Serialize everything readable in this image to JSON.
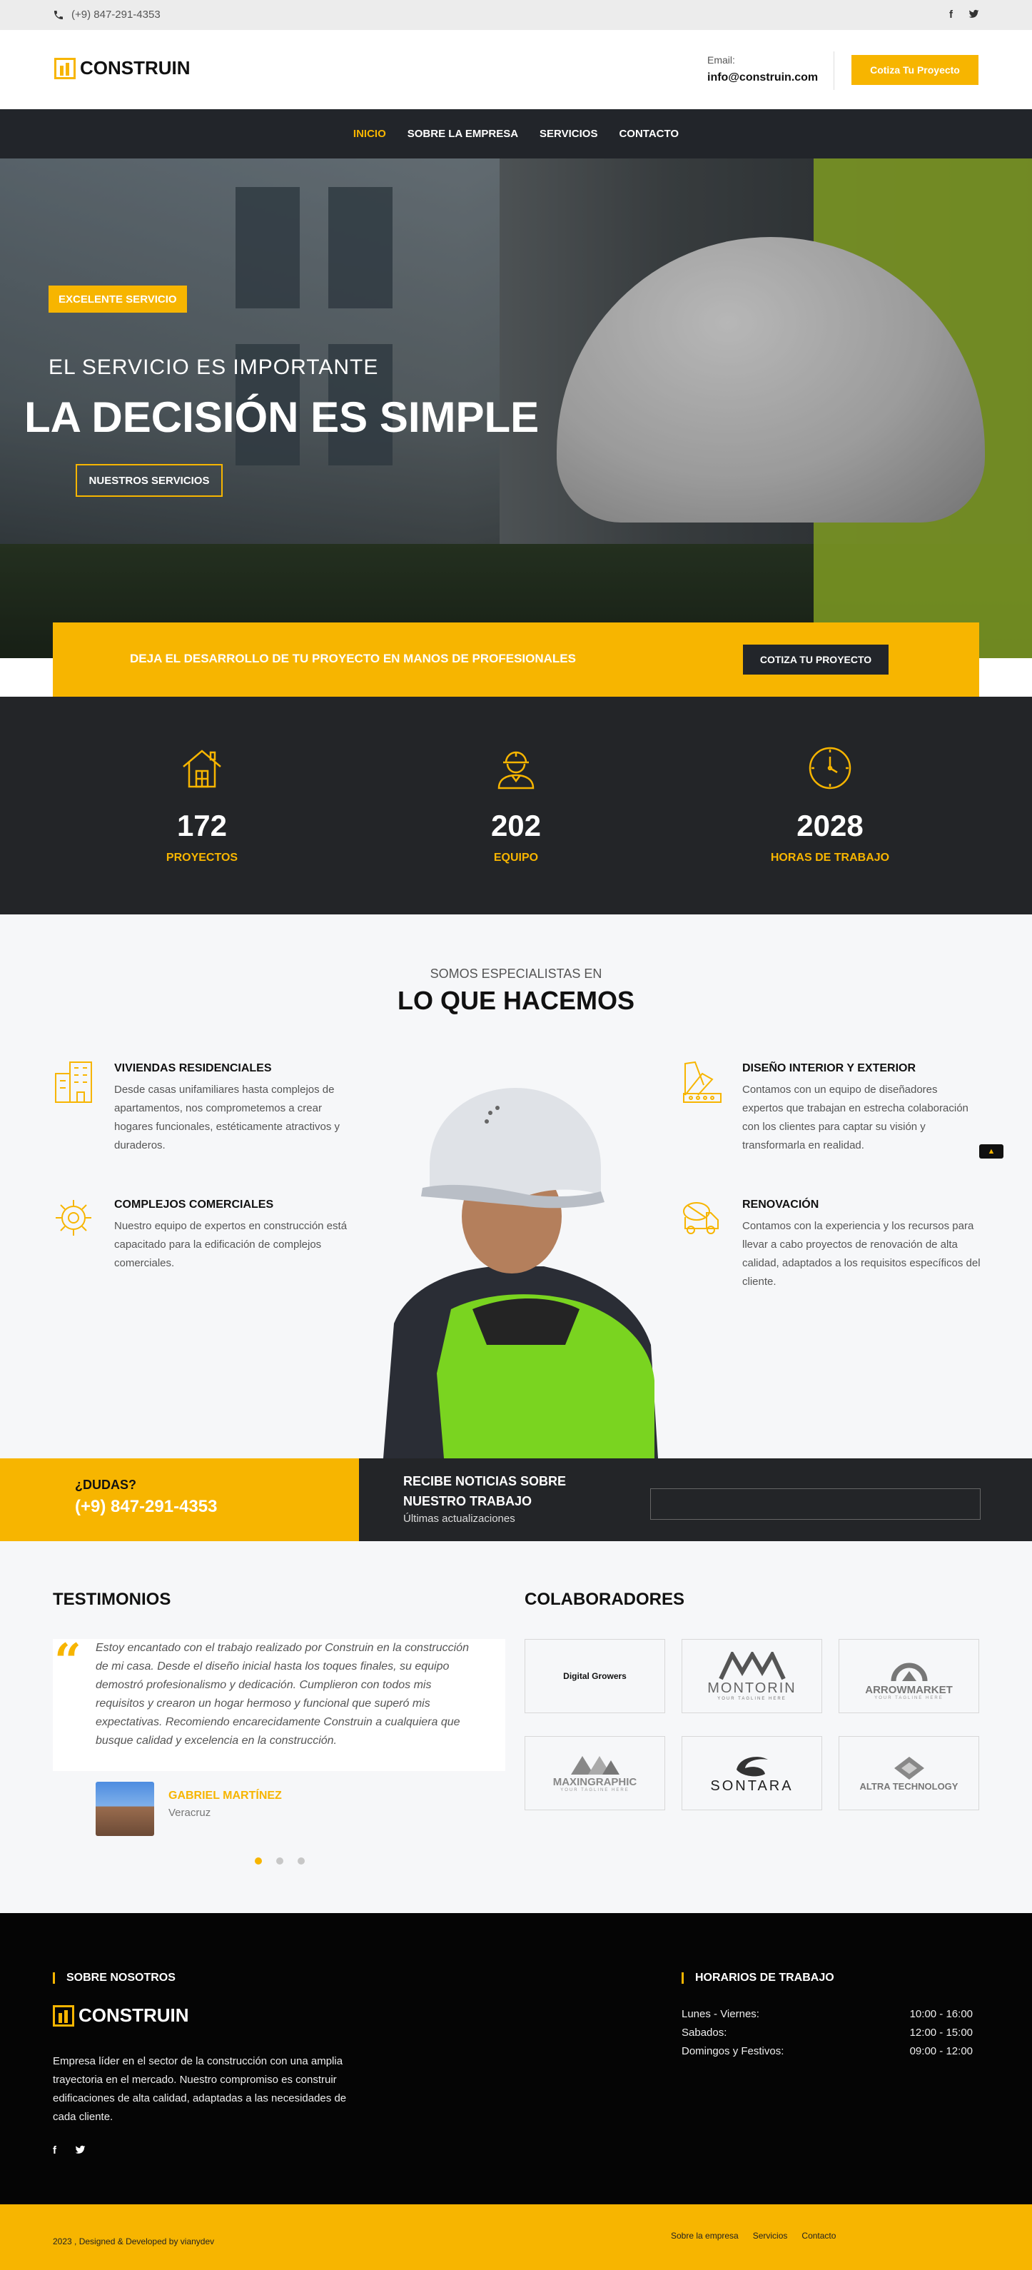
{
  "topbar": {
    "phone": "(+9) 847-291-4353",
    "social_icons": [
      "facebook-icon",
      "twitter-icon"
    ]
  },
  "header": {
    "logo": "CONSTRUIN",
    "email_label": "Email:",
    "email_value": "info@construin.com",
    "cta": "Cotiza Tu Proyecto"
  },
  "nav": {
    "items": [
      {
        "label": "INICIO",
        "active": true
      },
      {
        "label": "SOBRE LA EMPRESA",
        "active": false
      },
      {
        "label": "SERVICIOS",
        "active": false
      },
      {
        "label": "CONTACTO",
        "active": false
      }
    ]
  },
  "hero": {
    "badge": "EXCELENTE SERVICIO",
    "subtitle": "EL SERVICIO ES IMPORTANTE",
    "title": "LA DECISIÓN ES SIMPLE",
    "button": "NUESTROS SERVICIOS"
  },
  "strip": {
    "text": "DEJA EL DESARROLLO DE TU PROYECTO EN MANOS DE PROFESIONALES",
    "button": "COTIZA TU PROYECTO"
  },
  "stats": [
    {
      "value": "172",
      "label": "PROYECTOS",
      "icon": "house-icon"
    },
    {
      "value": "202",
      "label": "EQUIPO",
      "icon": "worker-icon"
    },
    {
      "value": "2028",
      "label": "HORAS DE TRABAJO",
      "icon": "clock-icon"
    }
  ],
  "services": {
    "kicker": "SOMOS ESPECIALISTAS EN",
    "heading": "LO QUE HACEMOS",
    "items": [
      {
        "title": "VIVIENDAS RESIDENCIALES",
        "desc": "Desde casas unifamiliares hasta complejos de apartamentos, nos comprometemos a crear hogares funcionales, estéticamente atractivos y duraderos.",
        "icon": "building-icon"
      },
      {
        "title": "COMPLEJOS COMERCIALES",
        "desc": "Nuestro equipo de expertos en construcción está capacitado para la edificación de complejos comerciales.",
        "icon": "gear-tools-icon"
      },
      {
        "title": "DISEÑO INTERIOR Y EXTERIOR",
        "desc": "Contamos con un equipo de diseñadores expertos que trabajan en estrecha colaboración con los clientes para captar su visión y transformarla en realidad.",
        "icon": "palette-icon"
      },
      {
        "title": "RENOVACIÓN",
        "desc": "Contamos con la experiencia y los recursos para llevar a cabo proyectos de renovación de alta calidad, adaptados a los requisitos específicos del cliente.",
        "icon": "truck-icon"
      }
    ]
  },
  "newsletter": {
    "question": "¿DUDAS?",
    "phone": "(+9) 847-291-4353",
    "title": "RECIBE NOTICIAS SOBRE NUESTRO TRABAJO",
    "subtitle": "Últimas actualizaciones"
  },
  "testimonials": {
    "title": "TESTIMONIOS",
    "quote": "Estoy encantado con el trabajo realizado por Construin en la construcción de mi casa. Desde el diseño inicial hasta los toques finales, su equipo demostró profesionalismo y dedicación. Cumplieron con todos mis requisitos y crearon un hogar hermoso y funcional que superó mis expectativas. Recomiendo encarecidamente Construin a cualquiera que busque calidad y excelencia en la construcción.",
    "name": "GABRIEL MARTÍNEZ",
    "location": "Veracruz"
  },
  "partners": {
    "title": "COLABORADORES",
    "logos": [
      {
        "main": "Digital Growers",
        "sub": ""
      },
      {
        "main": "MONTORIN",
        "sub": "YOUR TAGLINE HERE"
      },
      {
        "main": "ARROWMARKET",
        "sub": "YOUR TAGLINE HERE"
      },
      {
        "main": "MAXINGRAPHIC",
        "sub": "YOUR TAGLINE HERE"
      },
      {
        "main": "SONTARA",
        "sub": ""
      },
      {
        "main": "ALTRA TECHNOLOGY",
        "sub": ""
      }
    ]
  },
  "footer": {
    "about_title": "SOBRE NOSOTROS",
    "logo": "CONSTRUIN",
    "about_text": "Empresa líder en el sector de la construcción con una amplia trayectoria en el mercado. Nuestro compromiso es construir edificaciones de alta calidad, adaptadas a las necesidades de cada cliente.",
    "hours_title": "HORARIOS DE TRABAJO",
    "hours": [
      {
        "day": "Lunes - Viernes:",
        "time": "10:00 - 16:00"
      },
      {
        "day": "Sabados:",
        "time": "12:00 - 15:00"
      },
      {
        "day": "Domingos y Festivos:",
        "time": "09:00 - 12:00"
      }
    ],
    "copyright": "2023 , Designed & Developed by vianydev",
    "links": [
      "Sobre la empresa",
      "Servicios",
      "Contacto"
    ]
  },
  "colors": {
    "accent": "#f7b500",
    "dark": "#232528",
    "nav": "#22252a",
    "footer": "#050505"
  }
}
